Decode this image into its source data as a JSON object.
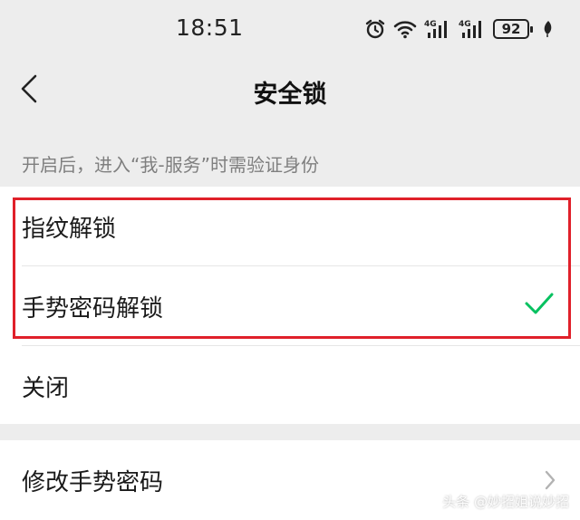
{
  "status_bar": {
    "time": "18:51",
    "battery": "92",
    "network_1": "4G",
    "network_2": "4G",
    "icons": [
      "alarm-icon",
      "wifi-icon",
      "signal-4g-icon",
      "signal-4g-icon",
      "battery-icon",
      "leaf-icon"
    ]
  },
  "nav": {
    "title": "安全锁",
    "back_icon": "chevron-left-icon"
  },
  "hint": "开启后，进入“我-服务”时需验证身份",
  "options": [
    {
      "label": "指纹解锁",
      "selected": false
    },
    {
      "label": "手势密码解锁",
      "selected": true
    },
    {
      "label": "关闭",
      "selected": false
    }
  ],
  "settings": [
    {
      "label": "修改手势密码",
      "icon": "chevron-right-icon"
    }
  ],
  "colors": {
    "accent_check": "#07c160",
    "highlight_border": "#e0202a",
    "background": "#ededed"
  },
  "watermark": "头条 @妙招姐说妙招"
}
